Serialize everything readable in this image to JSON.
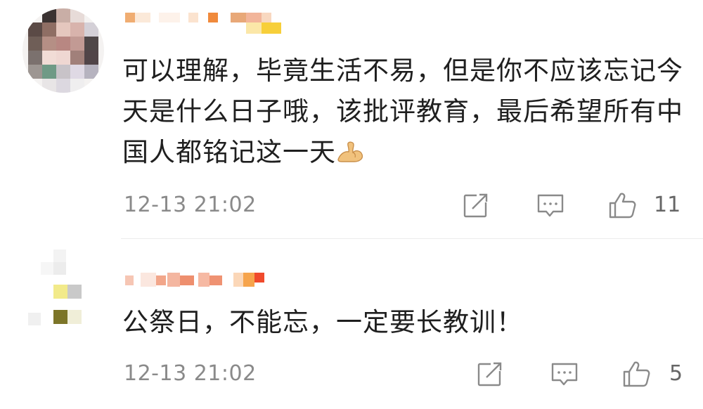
{
  "comments": [
    {
      "user_name": "",
      "text": "可以理解，毕竟生活不易，但是你不应该忘记今天是什么日子哦，该批评教育，最后希望所有中国人都铭记这一天",
      "emoji": "muscle-emoji",
      "timestamp": "12-13 21:02",
      "likes": "11"
    },
    {
      "user_name": "",
      "text": "公祭日，不能忘，一定要长教训！",
      "timestamp": "12-13 21:02",
      "likes": "5"
    }
  ],
  "icons": {
    "share": "share-icon",
    "reply": "comment-icon",
    "like": "thumbs-up-icon"
  },
  "colors": {
    "text": "#1f1f1f",
    "meta": "#8a8a8a",
    "icon": "#888888",
    "background": "#ffffff"
  }
}
